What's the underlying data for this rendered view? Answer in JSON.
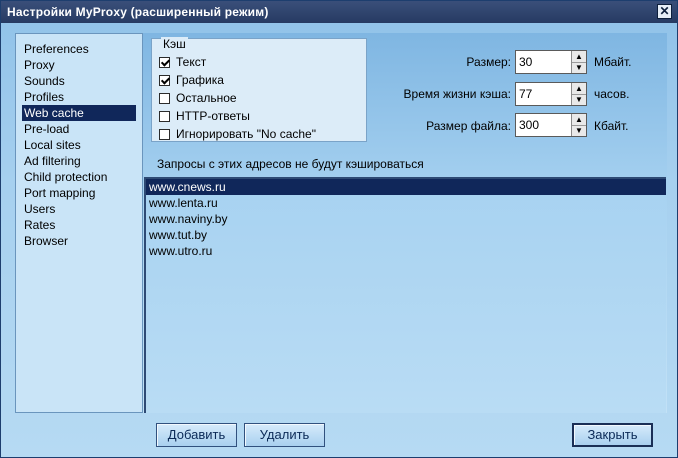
{
  "window": {
    "title": "Настройки MyProxy (расширенный режим)"
  },
  "sidebar": {
    "items": [
      {
        "label": "Preferences"
      },
      {
        "label": "Proxy"
      },
      {
        "label": "Sounds"
      },
      {
        "label": "Profiles"
      },
      {
        "label": "Web cache",
        "selected": true
      },
      {
        "label": "Pre-load"
      },
      {
        "label": "Local sites"
      },
      {
        "label": "Ad filtering"
      },
      {
        "label": "Child protection"
      },
      {
        "label": "Port mapping"
      },
      {
        "label": "Users"
      },
      {
        "label": "Rates"
      },
      {
        "label": "Browser"
      }
    ]
  },
  "cache_group": {
    "legend": "Кэш",
    "options": [
      {
        "label": "Текст",
        "checked": true
      },
      {
        "label": "Графика",
        "checked": true
      },
      {
        "label": "Остальное",
        "checked": false
      },
      {
        "label": "HTTP-ответы",
        "checked": false
      },
      {
        "label": "Игнорировать \"No cache\"",
        "checked": false
      }
    ]
  },
  "settings": {
    "size": {
      "label": "Размер:",
      "value": "30",
      "unit": "Мбайт."
    },
    "ttl": {
      "label": "Время жизни кэша:",
      "value": "77",
      "unit": "часов."
    },
    "file_size": {
      "label": "Размер файла:",
      "value": "300",
      "unit": "Кбайт."
    }
  },
  "exclusions": {
    "caption": "Запросы с этих адресов не будут кэшироваться",
    "urls": [
      "www.cnews.ru",
      "www.lenta.ru",
      "www.naviny.by",
      "www.tut.by",
      "www.utro.ru"
    ],
    "selected_index": 0
  },
  "buttons": {
    "add": "Добавить",
    "remove": "Удалить",
    "close": "Закрыть"
  },
  "icons": {
    "close": "close-icon",
    "spin_up": "arrow-up-icon",
    "spin_down": "arrow-down-icon"
  }
}
